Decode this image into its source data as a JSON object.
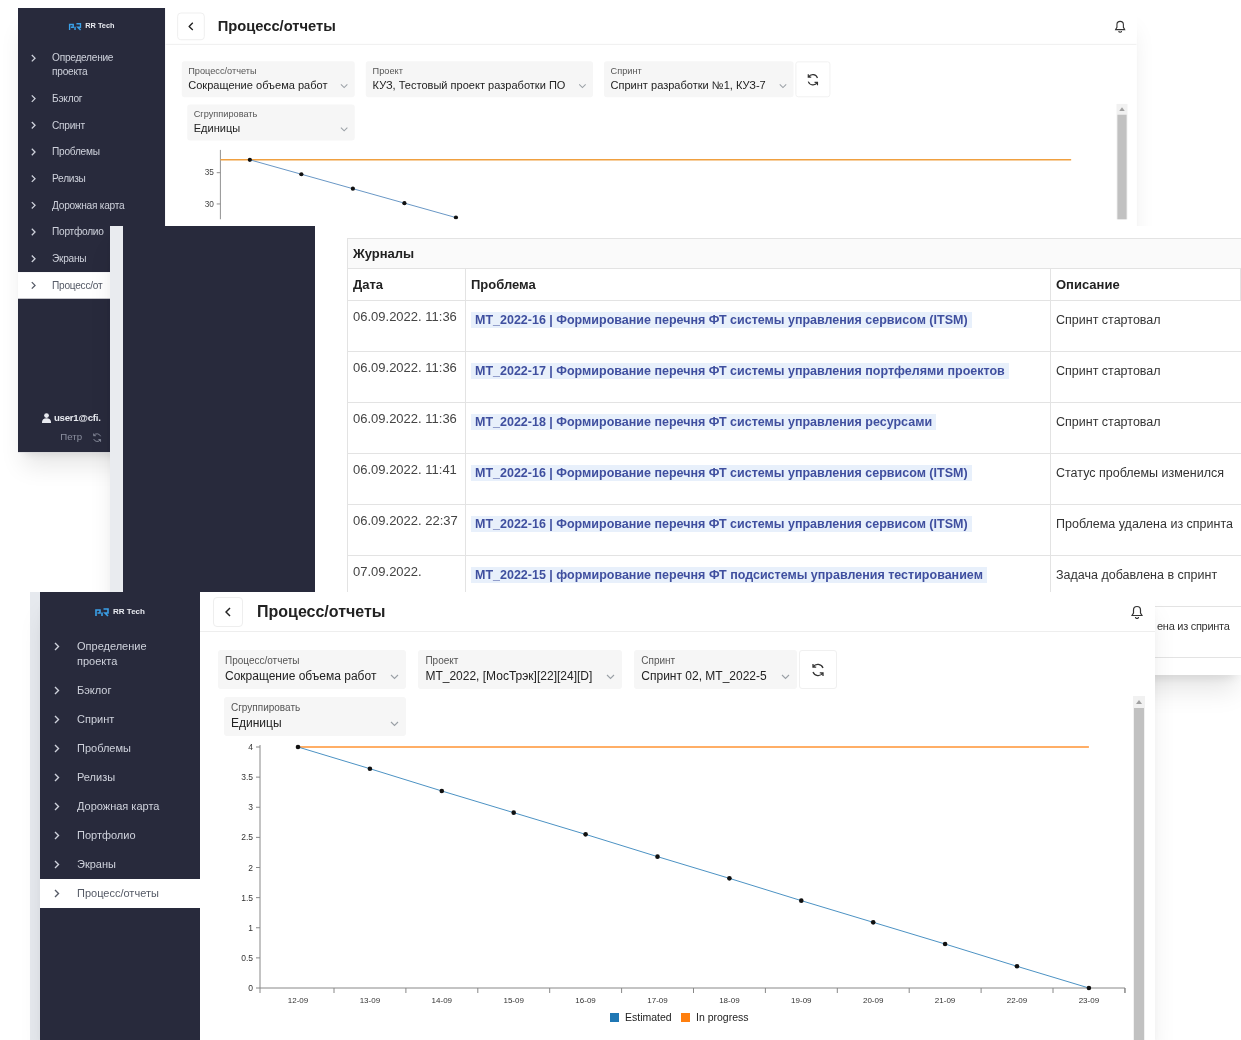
{
  "back_window": {
    "logo": "RR Tech",
    "title": "Процесс/отчеты",
    "sidebar": [
      {
        "label": "Определение проекта",
        "selected": false
      },
      {
        "label": "Бэклог",
        "selected": false
      },
      {
        "label": "Спринт",
        "selected": false
      },
      {
        "label": "Проблемы",
        "selected": false
      },
      {
        "label": "Релизы",
        "selected": false
      },
      {
        "label": "Дорожная карта",
        "selected": false
      },
      {
        "label": "Портфолио",
        "selected": false
      },
      {
        "label": "Экраны",
        "selected": false
      },
      {
        "label": "Процесс/от",
        "selected": true
      }
    ],
    "user": {
      "email": "user1@cfi.",
      "name": "Петр"
    },
    "filters": [
      {
        "label": "Процесс/отчеты",
        "value": "Сокращение объема работ"
      },
      {
        "label": "Проект",
        "value": "КУЗ, Тестовый проект разработки ПО"
      },
      {
        "label": "Спринт",
        "value": "Спринт разработки №1, КУЗ-7"
      }
    ],
    "group": {
      "label": "Сгруппировать",
      "value": "Единицы"
    },
    "chart_preview": {
      "ytick_labels": [
        "35",
        "30"
      ]
    }
  },
  "journal_window": {
    "title": "Журналы",
    "columns": [
      "Дата",
      "Проблема",
      "Описание"
    ],
    "rows": [
      {
        "date": "06.09.2022. 11:36",
        "issue": "MT_2022-16 | Формирование перечня ФТ системы управления сервисом (ITSM)",
        "description": "Спринт стартовал"
      },
      {
        "date": "06.09.2022. 11:36",
        "issue": "MT_2022-17 | Формирование перечня ФТ системы управления портфелями проектов",
        "description": "Спринт стартовал"
      },
      {
        "date": "06.09.2022. 11:36",
        "issue": "MT_2022-18 | Формирование перечня ФТ системы управления ресурсами",
        "description": "Спринт стартовал"
      },
      {
        "date": "06.09.2022. 11:41",
        "issue": "MT_2022-16 | Формирование перечня ФТ системы управления сервисом (ITSM)",
        "description": "Статус проблемы изменился"
      },
      {
        "date": "06.09.2022. 22:37",
        "issue": "MT_2022-16 | Формирование перечня ФТ системы управления сервисом (ITSM)",
        "description": "Проблема удалена из спринта"
      },
      {
        "date": "07.09.2022.",
        "issue": "MT_2022-15 | формирование перечня ФТ подсистемы управления тестированием",
        "description": "Задача добавлена в спринт"
      },
      {
        "description_tail": "ена из спринта"
      }
    ]
  },
  "front_window": {
    "logo": "RR Tech",
    "title": "Процесс/отчеты",
    "sidebar": [
      {
        "label": "Определение проекта",
        "selected": false
      },
      {
        "label": "Бэклог",
        "selected": false
      },
      {
        "label": "Спринт",
        "selected": false
      },
      {
        "label": "Проблемы",
        "selected": false
      },
      {
        "label": "Релизы",
        "selected": false
      },
      {
        "label": "Дорожная карта",
        "selected": false
      },
      {
        "label": "Портфолио",
        "selected": false
      },
      {
        "label": "Экраны",
        "selected": false
      },
      {
        "label": "Процесс/отчеты",
        "selected": true
      }
    ],
    "filters": [
      {
        "label": "Процесс/отчеты",
        "value": "Сокращение объема работ"
      },
      {
        "label": "Проект",
        "value": "MT_2022, [МосТрэк][22][24][D]"
      },
      {
        "label": "Спринт",
        "value": "Спринт 02, MT_2022-5"
      }
    ],
    "group": {
      "label": "Сгруппировать",
      "value": "Единицы"
    },
    "chart_data": {
      "type": "line",
      "categories": [
        "12-09",
        "13-09",
        "14-09",
        "15-09",
        "16-09",
        "17-09",
        "18-09",
        "19-09",
        "20-09",
        "21-09",
        "22-09",
        "23-09"
      ],
      "series": [
        {
          "name": "Estimated",
          "color": "#1f77b4",
          "values": [
            4,
            3.64,
            3.27,
            2.91,
            2.55,
            2.18,
            1.82,
            1.45,
            1.09,
            0.73,
            0.36,
            0
          ]
        },
        {
          "name": "In progress",
          "color": "#ff7f0e",
          "values": [
            4,
            4,
            4,
            4,
            4,
            4,
            4,
            4,
            4,
            4,
            4,
            4
          ]
        }
      ],
      "legend": "bottom",
      "ylim": [
        0,
        4
      ],
      "yticks": [
        0,
        0.5,
        1,
        1.5,
        2,
        2.5,
        3,
        3.5,
        4
      ]
    }
  }
}
